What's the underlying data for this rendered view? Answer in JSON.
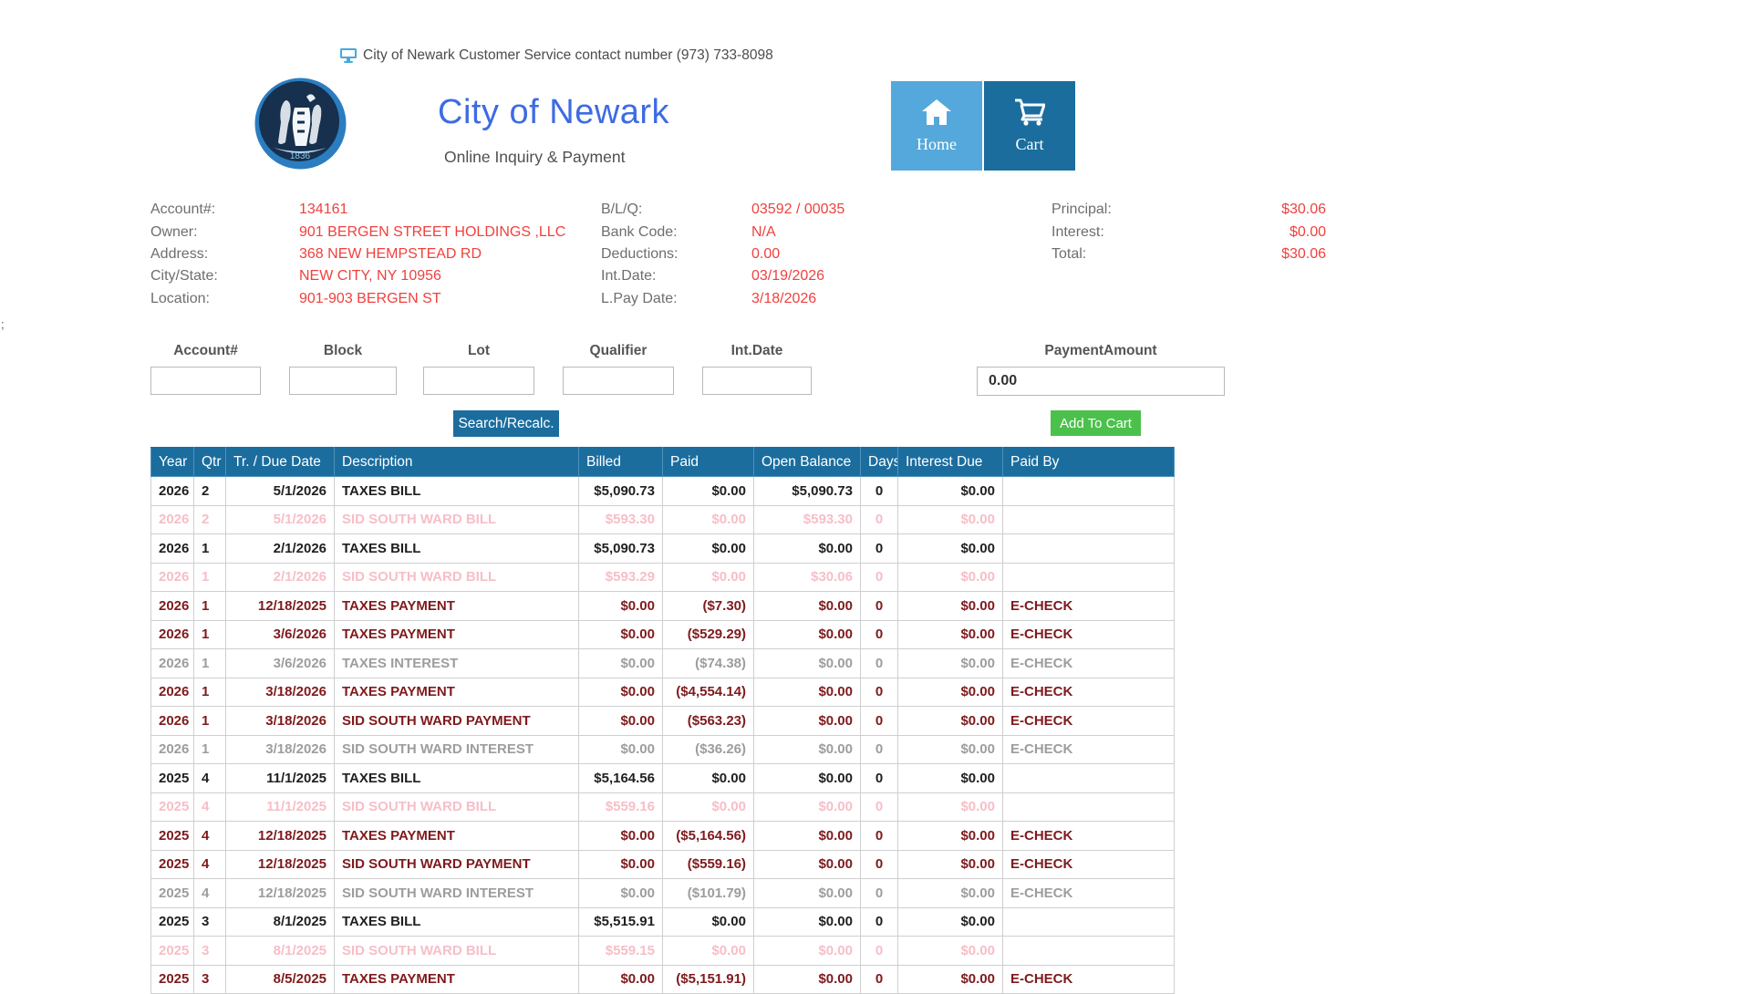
{
  "stray_text": ";",
  "topbar": {
    "contact_text": "City of Newark Customer Service contact number (973) 733-8098"
  },
  "header": {
    "title": "City of Newark",
    "subtitle": "Online Inquiry & Payment",
    "seal_year": "1836",
    "home_label": "Home",
    "cart_label": "Cart"
  },
  "account_info": {
    "columns": [
      {
        "rows": [
          {
            "label": "Account#:",
            "value": "134161"
          },
          {
            "label": "Owner:",
            "value": "901 BERGEN STREET HOLDINGS ,LLC"
          },
          {
            "label": "Address:",
            "value": "368 NEW HEMPSTEAD RD"
          },
          {
            "label": "City/State:",
            "value": "NEW CITY, NY 10956"
          },
          {
            "label": "Location:",
            "value": "901-903 BERGEN ST"
          }
        ]
      },
      {
        "rows": [
          {
            "label": "B/L/Q:",
            "value": "03592 / 00035"
          },
          {
            "label": "Bank Code:",
            "value": "N/A"
          },
          {
            "label": "Deductions:",
            "value": "0.00"
          },
          {
            "label": "Int.Date:",
            "value": "03/19/2026"
          },
          {
            "label": "L.Pay Date:",
            "value": "3/18/2026"
          }
        ]
      },
      {
        "rows": [
          {
            "label": "Principal:",
            "value": "$30.06"
          },
          {
            "label": "Interest:",
            "value": "$0.00"
          },
          {
            "label": "Total:",
            "value": "$30.06"
          }
        ]
      }
    ]
  },
  "search_form": {
    "fields": [
      {
        "name": "account",
        "label": "Account#",
        "value": ""
      },
      {
        "name": "block",
        "label": "Block",
        "value": ""
      },
      {
        "name": "lot",
        "label": "Lot",
        "value": ""
      },
      {
        "name": "qualifier",
        "label": "Qualifier",
        "value": ""
      },
      {
        "name": "intdate",
        "label": "Int.Date",
        "value": ""
      }
    ],
    "payment": {
      "label": "PaymentAmount",
      "value": "0.00"
    },
    "search_button": "Search/Recalc.",
    "add_to_cart_button": "Add To Cart"
  },
  "table": {
    "columns": [
      "Year",
      "Qtr",
      "Tr. / Due Date",
      "Description",
      "Billed",
      "Paid",
      "Open Balance",
      "Days",
      "Interest Due",
      "Paid By"
    ],
    "rows": [
      {
        "year": "2026",
        "qtr": "2",
        "date": "5/1/2026",
        "description": "TAXES BILL",
        "billed": "$5,090.73",
        "paid": "$0.00",
        "open_balance": "$5,090.73",
        "days": "0",
        "interest_due": "$0.00",
        "paid_by": "",
        "variant": "bill"
      },
      {
        "year": "2026",
        "qtr": "2",
        "date": "5/1/2026",
        "description": "SID SOUTH WARD BILL",
        "billed": "$593.30",
        "paid": "$0.00",
        "open_balance": "$593.30",
        "days": "0",
        "interest_due": "$0.00",
        "paid_by": "",
        "variant": "sid-bill"
      },
      {
        "year": "2026",
        "qtr": "1",
        "date": "2/1/2026",
        "description": "TAXES BILL",
        "billed": "$5,090.73",
        "paid": "$0.00",
        "open_balance": "$0.00",
        "days": "0",
        "interest_due": "$0.00",
        "paid_by": "",
        "variant": "bill"
      },
      {
        "year": "2026",
        "qtr": "1",
        "date": "2/1/2026",
        "description": "SID SOUTH WARD BILL",
        "billed": "$593.29",
        "paid": "$0.00",
        "open_balance": "$30.06",
        "days": "0",
        "interest_due": "$0.00",
        "paid_by": "",
        "variant": "sid-bill"
      },
      {
        "year": "2026",
        "qtr": "1",
        "date": "12/18/2025",
        "description": "TAXES PAYMENT",
        "billed": "$0.00",
        "paid": "($7.30)",
        "open_balance": "$0.00",
        "days": "0",
        "interest_due": "$0.00",
        "paid_by": "E-CHECK",
        "variant": "payment"
      },
      {
        "year": "2026",
        "qtr": "1",
        "date": "3/6/2026",
        "description": "TAXES PAYMENT",
        "billed": "$0.00",
        "paid": "($529.29)",
        "open_balance": "$0.00",
        "days": "0",
        "interest_due": "$0.00",
        "paid_by": "E-CHECK",
        "variant": "payment"
      },
      {
        "year": "2026",
        "qtr": "1",
        "date": "3/6/2026",
        "description": "TAXES INTEREST",
        "billed": "$0.00",
        "paid": "($74.38)",
        "open_balance": "$0.00",
        "days": "0",
        "interest_due": "$0.00",
        "paid_by": "E-CHECK",
        "variant": "interest"
      },
      {
        "year": "2026",
        "qtr": "1",
        "date": "3/18/2026",
        "description": "TAXES PAYMENT",
        "billed": "$0.00",
        "paid": "($4,554.14)",
        "open_balance": "$0.00",
        "days": "0",
        "interest_due": "$0.00",
        "paid_by": "E-CHECK",
        "variant": "payment"
      },
      {
        "year": "2026",
        "qtr": "1",
        "date": "3/18/2026",
        "description": "SID SOUTH WARD PAYMENT",
        "billed": "$0.00",
        "paid": "($563.23)",
        "open_balance": "$0.00",
        "days": "0",
        "interest_due": "$0.00",
        "paid_by": "E-CHECK",
        "variant": "payment"
      },
      {
        "year": "2026",
        "qtr": "1",
        "date": "3/18/2026",
        "description": "SID SOUTH WARD INTEREST",
        "billed": "$0.00",
        "paid": "($36.26)",
        "open_balance": "$0.00",
        "days": "0",
        "interest_due": "$0.00",
        "paid_by": "E-CHECK",
        "variant": "interest"
      },
      {
        "year": "2025",
        "qtr": "4",
        "date": "11/1/2025",
        "description": "TAXES BILL",
        "billed": "$5,164.56",
        "paid": "$0.00",
        "open_balance": "$0.00",
        "days": "0",
        "interest_due": "$0.00",
        "paid_by": "",
        "variant": "bill"
      },
      {
        "year": "2025",
        "qtr": "4",
        "date": "11/1/2025",
        "description": "SID SOUTH WARD BILL",
        "billed": "$559.16",
        "paid": "$0.00",
        "open_balance": "$0.00",
        "days": "0",
        "interest_due": "$0.00",
        "paid_by": "",
        "variant": "sid-bill"
      },
      {
        "year": "2025",
        "qtr": "4",
        "date": "12/18/2025",
        "description": "TAXES PAYMENT",
        "billed": "$0.00",
        "paid": "($5,164.56)",
        "open_balance": "$0.00",
        "days": "0",
        "interest_due": "$0.00",
        "paid_by": "E-CHECK",
        "variant": "payment"
      },
      {
        "year": "2025",
        "qtr": "4",
        "date": "12/18/2025",
        "description": "SID SOUTH WARD PAYMENT",
        "billed": "$0.00",
        "paid": "($559.16)",
        "open_balance": "$0.00",
        "days": "0",
        "interest_due": "$0.00",
        "paid_by": "E-CHECK",
        "variant": "payment"
      },
      {
        "year": "2025",
        "qtr": "4",
        "date": "12/18/2025",
        "description": "SID SOUTH WARD INTEREST",
        "billed": "$0.00",
        "paid": "($101.79)",
        "open_balance": "$0.00",
        "days": "0",
        "interest_due": "$0.00",
        "paid_by": "E-CHECK",
        "variant": "interest"
      },
      {
        "year": "2025",
        "qtr": "3",
        "date": "8/1/2025",
        "description": "TAXES BILL",
        "billed": "$5,515.91",
        "paid": "$0.00",
        "open_balance": "$0.00",
        "days": "0",
        "interest_due": "$0.00",
        "paid_by": "",
        "variant": "bill"
      },
      {
        "year": "2025",
        "qtr": "3",
        "date": "8/1/2025",
        "description": "SID SOUTH WARD BILL",
        "billed": "$559.15",
        "paid": "$0.00",
        "open_balance": "$0.00",
        "days": "0",
        "interest_due": "$0.00",
        "paid_by": "",
        "variant": "sid-bill"
      },
      {
        "year": "2025",
        "qtr": "3",
        "date": "8/5/2025",
        "description": "TAXES PAYMENT",
        "billed": "$0.00",
        "paid": "($5,151.91)",
        "open_balance": "$0.00",
        "days": "0",
        "interest_due": "$0.00",
        "paid_by": "E-CHECK",
        "variant": "payment"
      }
    ]
  },
  "colors": {
    "dark_blue": "#1b6d9e",
    "light_blue": "#55a8db",
    "green": "#4bc14b",
    "accent_red": "#ef413e",
    "title_blue": "#3d6be4",
    "row_bill": "#1f1f1f",
    "row_sid_bill": "#f7bec7",
    "row_payment": "#7f1a1c",
    "row_interest": "#9d9d9d"
  }
}
